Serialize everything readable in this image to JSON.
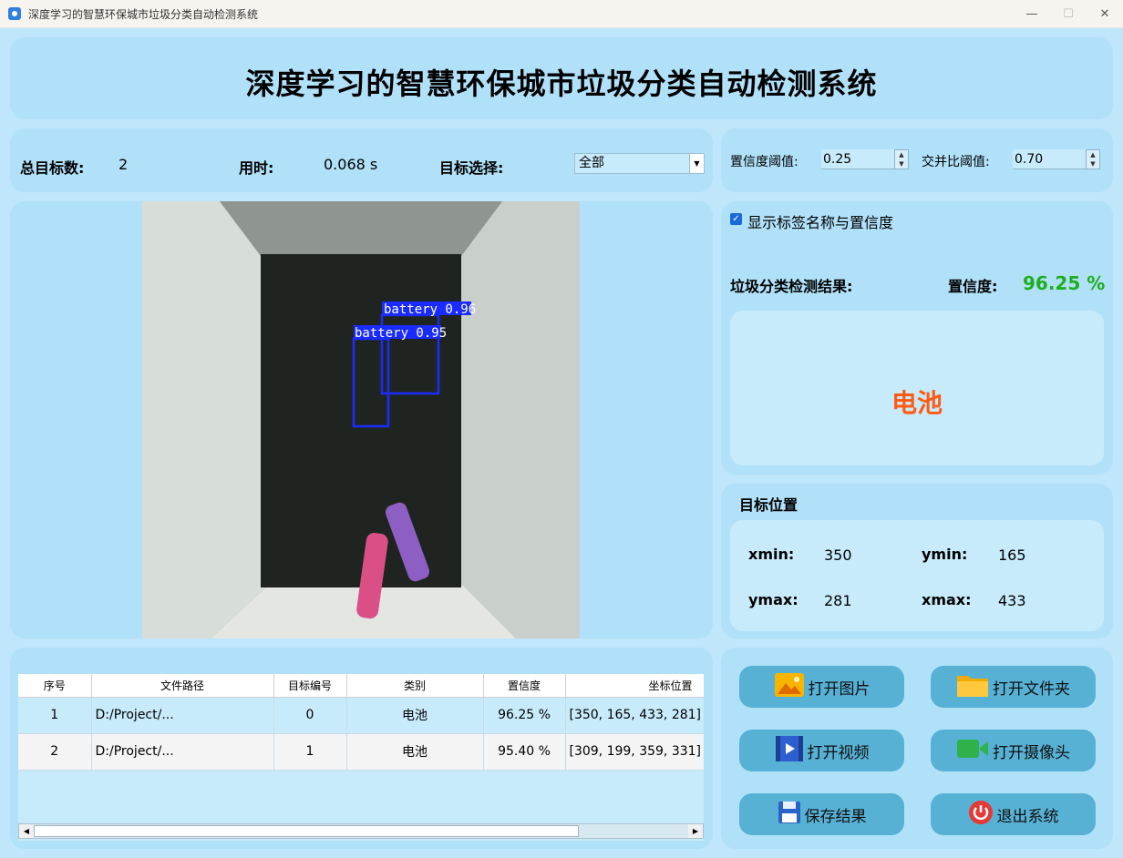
{
  "window": {
    "title": "深度学习的智慧环保城市垃圾分类自动检测系统"
  },
  "header": {
    "title": "深度学习的智慧环保城市垃圾分类自动检测系统"
  },
  "stats": {
    "total_label": "总目标数:",
    "total_value": "2",
    "time_label": "用时:",
    "time_value": "0.068 s",
    "select_label": "目标选择:",
    "select_value": "全部"
  },
  "params": {
    "conf_label": "置信度阈值:",
    "conf_value": "0.25",
    "iou_label": "交并比阈值:",
    "iou_value": "0.70"
  },
  "detections_overlay": [
    {
      "label": "battery 0.96"
    },
    {
      "label": "battery 0.95"
    }
  ],
  "options": {
    "show_labels": "显示标签名称与置信度",
    "show_labels_checked": true
  },
  "result": {
    "title": "垃圾分类检测结果:",
    "conf_label": "置信度:",
    "conf_value": "96.25 %",
    "class_name": "电池"
  },
  "position": {
    "title": "目标位置",
    "xmin_label": "xmin:",
    "xmin_value": "350",
    "ymin_label": "ymin:",
    "ymin_value": "165",
    "ymax_label": "ymax:",
    "ymax_value": "281",
    "xmax_label": "xmax:",
    "xmax_value": "433"
  },
  "table": {
    "headers": [
      "序号",
      "文件路径",
      "目标编号",
      "类别",
      "置信度",
      "坐标位置"
    ],
    "rows": [
      [
        "1",
        "D:/Project/...",
        "0",
        "电池",
        "96.25 %",
        "[350, 165, 433, 281]"
      ],
      [
        "2",
        "D:/Project/...",
        "1",
        "电池",
        "95.40 %",
        "[309, 199, 359, 331]"
      ]
    ]
  },
  "buttons": {
    "open_image": "打开图片",
    "open_folder": "打开文件夹",
    "open_video": "打开视频",
    "open_camera": "打开摄像头",
    "save": "保存结果",
    "exit": "退出系统"
  },
  "colors": {
    "accent": "#1fae1f",
    "result": "#ff5a14",
    "button": "#56b1d4",
    "panel": "#b0e1f9",
    "bbox": "#1a2bff"
  }
}
